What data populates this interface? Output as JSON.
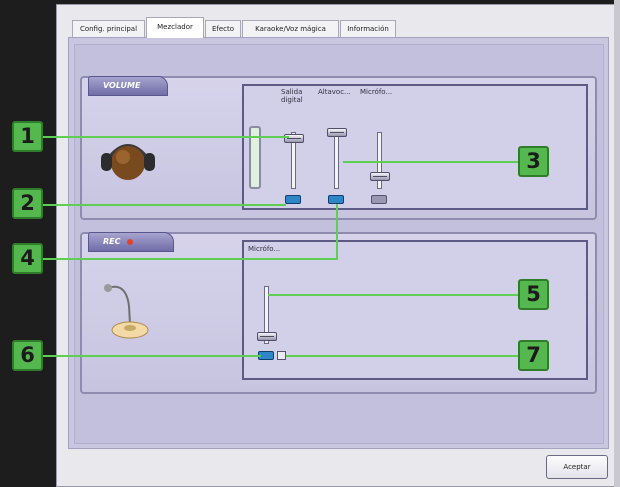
{
  "tabs": [
    {
      "label": "Config. principal"
    },
    {
      "label": "Mezclador"
    },
    {
      "label": "Efecto"
    },
    {
      "label": "Karaoke/Voz mágica"
    },
    {
      "label": "Información"
    }
  ],
  "active_tab": "Mezclador",
  "playback_section": {
    "title": "VOLUME",
    "columns": [
      "Salida digital",
      "Altavoc...",
      "Micrófo..."
    ]
  },
  "record_section": {
    "title": "REC",
    "columns": [
      "Micrófo..."
    ]
  },
  "callouts": [
    "1",
    "2",
    "3",
    "4",
    "5",
    "6",
    "7"
  ],
  "accept_label": "Aceptar",
  "colors": {
    "callout_green": "#55b84e",
    "mute_active_blue": "#2e86c7",
    "panel_lavender": "#c9c6e0"
  }
}
